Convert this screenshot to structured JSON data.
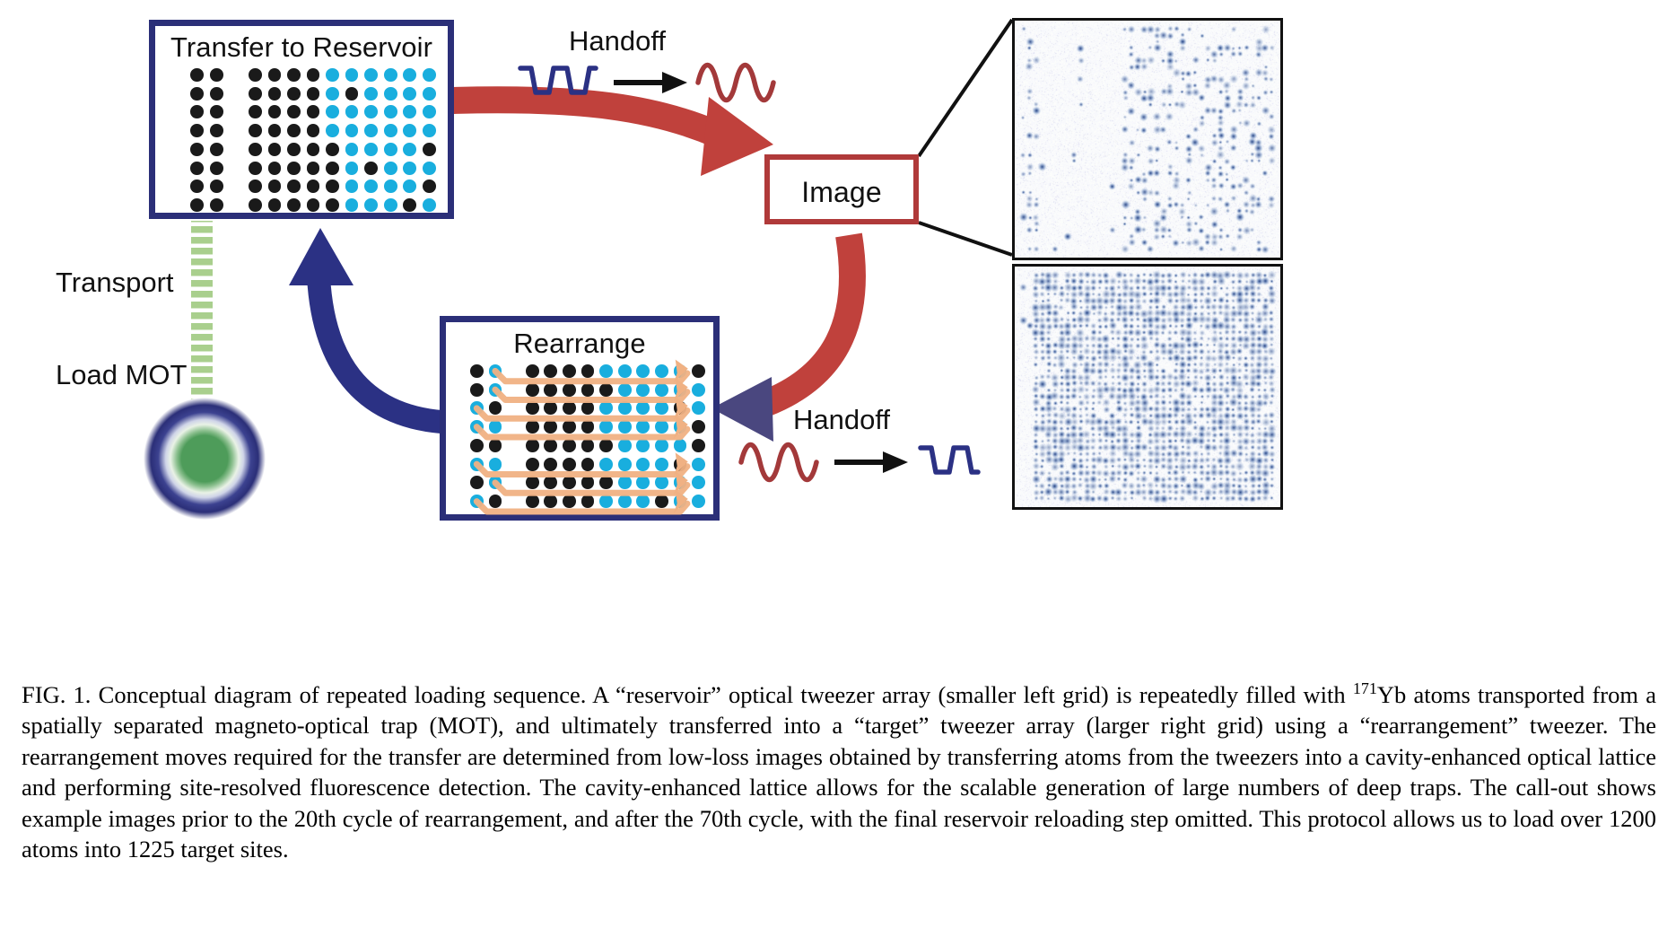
{
  "figure": {
    "label": "FIG. 1.",
    "caption_runs": [
      {
        "t": "FIG. 1. Conceptual diagram of repeated loading sequence. A “reservoir” optical tweezer array (smaller left grid) is repeatedly filled with "
      },
      {
        "t": "171",
        "sup": true
      },
      {
        "t": "Yb atoms transported from a spatially separated magneto-optical trap (MOT), and ultimately transferred into a “target” tweezer array (larger right grid) using a “rearrangement” tweezer. The rearrangement moves required for the transfer are determined from low-loss images obtained by transferring atoms from the tweezers into a cavity-enhanced optical lattice and performing site-resolved fluorescence detection. The cavity-enhanced lattice allows for the scalable generation of large numbers of deep traps. The call-out shows example images prior to the 20th cycle of rearrangement, and after the 70th cycle, with the final reservoir reloading step omitted. This protocol allows us to load over 1200 atoms into 1225 target sites."
      }
    ]
  },
  "colors": {
    "box_blue": "#2b2f78",
    "box_red": "#b03a3a",
    "dot_black": "#1a1a1a",
    "dot_cyan": "#19aede",
    "arrow_red": "#c0413c",
    "arrow_blue": "#2b3184",
    "arrow_purple": "#4a477f",
    "rearrange_path": "#f0b183",
    "transport_green": "#a9cf8d",
    "mot_core": "#4e9c5a",
    "mot_halo": "#2b2f78"
  },
  "boxes": {
    "reservoir": {
      "title": "Transfer to Reservoir"
    },
    "rearrange": {
      "title": "Rearrange"
    },
    "image": {
      "title": "Image"
    }
  },
  "labels": {
    "handoff_top": "Handoff",
    "handoff_bottom": "Handoff",
    "transport": "Transport",
    "load_mot": "Load MOT"
  },
  "icons": {
    "handoff_top": {
      "from": "square-dip-waveform",
      "arrow": "right-arrow",
      "to": "sine-waveform"
    },
    "handoff_bottom": {
      "from": "sine-waveform",
      "arrow": "right-arrow",
      "to": "square-dip-waveform"
    }
  },
  "reservoir_grid": {
    "note": "row-major; 'k'=black atom, 'c'=cyan target-site, '.'=empty gap column",
    "cols": 13,
    "rows": 8,
    "cells": [
      "kk.kkkkcccccc",
      "kk.kkkkckcccc",
      "kk.kkkkcccccc",
      "kk.kkkkcccccc",
      "kk.kkkkkcccck",
      "kk.kkkkkckccc",
      "kk.kkkkkcccck",
      "kk.kkkkkccckc"
    ]
  },
  "rearrange_grid": {
    "note": "row-major; 'k'=black atom, 'c'=cyan target-site, '.'=empty gap column",
    "cols": 13,
    "rows": 8,
    "cells": [
      "kc.kkkkccccck",
      "kc.kkkkkccccc",
      "ck.kkkkcccckc",
      "cc.kkkkccccck",
      "kk.kkkkkcccck",
      "cc.kkkkcccckc",
      "kc.kkkkkccccc",
      "ck.kkkkccckcc"
    ]
  },
  "rearrange_moves": {
    "note": "orange rearrangement tweezer paths: source row index, then step down to the transport lane and across to the right",
    "rows": [
      0,
      1,
      2,
      3,
      5,
      6,
      7
    ]
  },
  "fluorescence": {
    "top": {
      "name": "image-before-cycle-20",
      "filled_fraction": 0.34,
      "columns_filled_from": 0.42,
      "sparse_left_column": true
    },
    "bottom": {
      "name": "image-after-cycle-70",
      "filled_fraction": 0.92,
      "columns_filled_from": 0.05,
      "sparse_left_column": false
    }
  },
  "callout": {
    "from": "image-box",
    "to_panels": [
      "fluorescence-top",
      "fluorescence-bottom"
    ]
  }
}
